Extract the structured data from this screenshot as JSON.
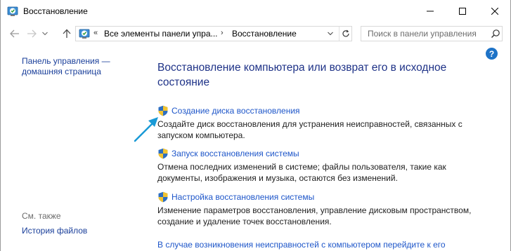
{
  "window": {
    "title": "Восстановление"
  },
  "address_bar": {
    "overflow": "«",
    "segments": [
      "Все элементы панели упра...",
      "Восстановление"
    ]
  },
  "search": {
    "placeholder": "Поиск в панели управления"
  },
  "help": {
    "label": "?"
  },
  "sidebar": {
    "home_line1": "Панель управления —",
    "home_line2": "домашняя страница",
    "see_also": "См. также",
    "file_history": "История файлов"
  },
  "main": {
    "title": "Восстановление компьютера или возврат его в исходное состояние",
    "tasks": [
      {
        "link": "Создание диска восстановления",
        "desc": "Создайте диск восстановления для устранения неисправностей, связанных с запуском компьютера."
      },
      {
        "link": "Запуск восстановления системы",
        "desc": "Отмена последних изменений в системе; файлы пользователя, такие как документы, изображения и музыка, остаются без изменений."
      },
      {
        "link": "Настройка восстановления системы",
        "desc": "Изменение параметров восстановления, управление дисковым пространством, создание и удаление точек восстановления."
      }
    ],
    "bottom_link": "В случае возникновения неисправностей с компьютером перейдите к его"
  },
  "colors": {
    "link": "#1e56c9",
    "title": "#1e3287",
    "annotation_arrow": "#1a9ad6",
    "help": "#1e73c7"
  },
  "icons": {
    "app": "control-panel-recovery-icon",
    "shield": "uac-shield-icon"
  }
}
